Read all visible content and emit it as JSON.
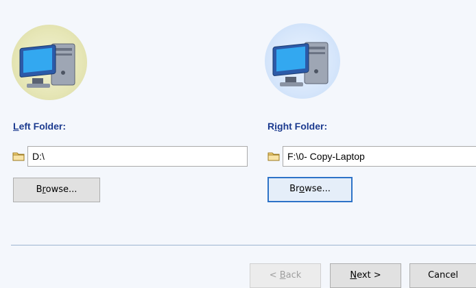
{
  "left": {
    "label_prefix": "L",
    "label_rest": "eft Folder:",
    "path": "D:\\",
    "browse_prefix": "B",
    "browse_u": "r",
    "browse_rest": "owse..."
  },
  "right": {
    "label_prefix": "R",
    "label_u": "i",
    "label_rest": "ght Folder:",
    "path": "F:\\0- Copy-Laptop",
    "browse_prefix": "Br",
    "browse_u": "o",
    "browse_rest": "wse..."
  },
  "footer": {
    "back_prefix": "< ",
    "back_u": "B",
    "back_rest": "ack",
    "next_u": "N",
    "next_rest": "ext >",
    "cancel_label": "Cancel"
  },
  "icons": {
    "computer": "computer-icon",
    "folder": "folder-icon"
  },
  "colors": {
    "label_blue": "#1b3a8f",
    "focus_blue": "#2c72c7",
    "divider": "#9bb3cf"
  }
}
